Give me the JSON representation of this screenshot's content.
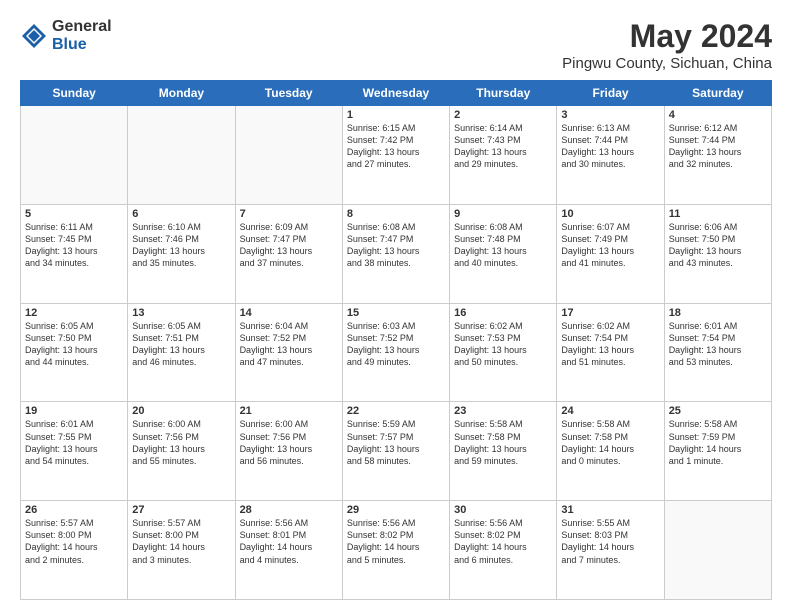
{
  "logo": {
    "general": "General",
    "blue": "Blue"
  },
  "header": {
    "title": "May 2024",
    "subtitle": "Pingwu County, Sichuan, China"
  },
  "days_of_week": [
    "Sunday",
    "Monday",
    "Tuesday",
    "Wednesday",
    "Thursday",
    "Friday",
    "Saturday"
  ],
  "weeks": [
    [
      {
        "day": "",
        "info": ""
      },
      {
        "day": "",
        "info": ""
      },
      {
        "day": "",
        "info": ""
      },
      {
        "day": "1",
        "info": "Sunrise: 6:15 AM\nSunset: 7:42 PM\nDaylight: 13 hours\nand 27 minutes."
      },
      {
        "day": "2",
        "info": "Sunrise: 6:14 AM\nSunset: 7:43 PM\nDaylight: 13 hours\nand 29 minutes."
      },
      {
        "day": "3",
        "info": "Sunrise: 6:13 AM\nSunset: 7:44 PM\nDaylight: 13 hours\nand 30 minutes."
      },
      {
        "day": "4",
        "info": "Sunrise: 6:12 AM\nSunset: 7:44 PM\nDaylight: 13 hours\nand 32 minutes."
      }
    ],
    [
      {
        "day": "5",
        "info": "Sunrise: 6:11 AM\nSunset: 7:45 PM\nDaylight: 13 hours\nand 34 minutes."
      },
      {
        "day": "6",
        "info": "Sunrise: 6:10 AM\nSunset: 7:46 PM\nDaylight: 13 hours\nand 35 minutes."
      },
      {
        "day": "7",
        "info": "Sunrise: 6:09 AM\nSunset: 7:47 PM\nDaylight: 13 hours\nand 37 minutes."
      },
      {
        "day": "8",
        "info": "Sunrise: 6:08 AM\nSunset: 7:47 PM\nDaylight: 13 hours\nand 38 minutes."
      },
      {
        "day": "9",
        "info": "Sunrise: 6:08 AM\nSunset: 7:48 PM\nDaylight: 13 hours\nand 40 minutes."
      },
      {
        "day": "10",
        "info": "Sunrise: 6:07 AM\nSunset: 7:49 PM\nDaylight: 13 hours\nand 41 minutes."
      },
      {
        "day": "11",
        "info": "Sunrise: 6:06 AM\nSunset: 7:50 PM\nDaylight: 13 hours\nand 43 minutes."
      }
    ],
    [
      {
        "day": "12",
        "info": "Sunrise: 6:05 AM\nSunset: 7:50 PM\nDaylight: 13 hours\nand 44 minutes."
      },
      {
        "day": "13",
        "info": "Sunrise: 6:05 AM\nSunset: 7:51 PM\nDaylight: 13 hours\nand 46 minutes."
      },
      {
        "day": "14",
        "info": "Sunrise: 6:04 AM\nSunset: 7:52 PM\nDaylight: 13 hours\nand 47 minutes."
      },
      {
        "day": "15",
        "info": "Sunrise: 6:03 AM\nSunset: 7:52 PM\nDaylight: 13 hours\nand 49 minutes."
      },
      {
        "day": "16",
        "info": "Sunrise: 6:02 AM\nSunset: 7:53 PM\nDaylight: 13 hours\nand 50 minutes."
      },
      {
        "day": "17",
        "info": "Sunrise: 6:02 AM\nSunset: 7:54 PM\nDaylight: 13 hours\nand 51 minutes."
      },
      {
        "day": "18",
        "info": "Sunrise: 6:01 AM\nSunset: 7:54 PM\nDaylight: 13 hours\nand 53 minutes."
      }
    ],
    [
      {
        "day": "19",
        "info": "Sunrise: 6:01 AM\nSunset: 7:55 PM\nDaylight: 13 hours\nand 54 minutes."
      },
      {
        "day": "20",
        "info": "Sunrise: 6:00 AM\nSunset: 7:56 PM\nDaylight: 13 hours\nand 55 minutes."
      },
      {
        "day": "21",
        "info": "Sunrise: 6:00 AM\nSunset: 7:56 PM\nDaylight: 13 hours\nand 56 minutes."
      },
      {
        "day": "22",
        "info": "Sunrise: 5:59 AM\nSunset: 7:57 PM\nDaylight: 13 hours\nand 58 minutes."
      },
      {
        "day": "23",
        "info": "Sunrise: 5:58 AM\nSunset: 7:58 PM\nDaylight: 13 hours\nand 59 minutes."
      },
      {
        "day": "24",
        "info": "Sunrise: 5:58 AM\nSunset: 7:58 PM\nDaylight: 14 hours\nand 0 minutes."
      },
      {
        "day": "25",
        "info": "Sunrise: 5:58 AM\nSunset: 7:59 PM\nDaylight: 14 hours\nand 1 minute."
      }
    ],
    [
      {
        "day": "26",
        "info": "Sunrise: 5:57 AM\nSunset: 8:00 PM\nDaylight: 14 hours\nand 2 minutes."
      },
      {
        "day": "27",
        "info": "Sunrise: 5:57 AM\nSunset: 8:00 PM\nDaylight: 14 hours\nand 3 minutes."
      },
      {
        "day": "28",
        "info": "Sunrise: 5:56 AM\nSunset: 8:01 PM\nDaylight: 14 hours\nand 4 minutes."
      },
      {
        "day": "29",
        "info": "Sunrise: 5:56 AM\nSunset: 8:02 PM\nDaylight: 14 hours\nand 5 minutes."
      },
      {
        "day": "30",
        "info": "Sunrise: 5:56 AM\nSunset: 8:02 PM\nDaylight: 14 hours\nand 6 minutes."
      },
      {
        "day": "31",
        "info": "Sunrise: 5:55 AM\nSunset: 8:03 PM\nDaylight: 14 hours\nand 7 minutes."
      },
      {
        "day": "",
        "info": ""
      }
    ]
  ]
}
